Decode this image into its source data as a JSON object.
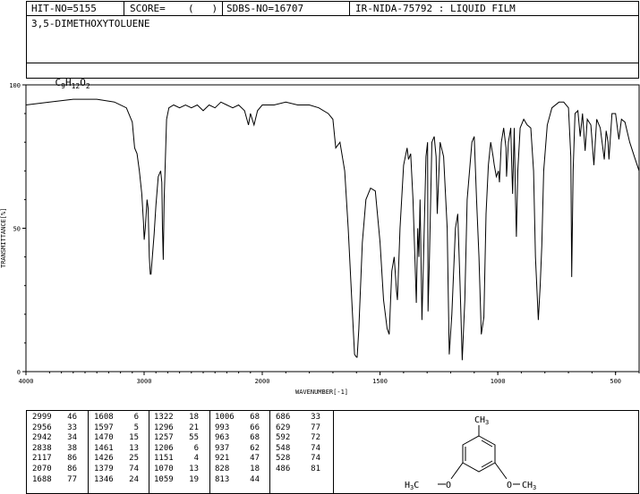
{
  "header": {
    "hit_no": "HIT-NO=5155",
    "score_label": "SCORE=",
    "score_value": "(   )",
    "sdbs_no": "SDBS-NO=16707",
    "ir_info": "IR-NIDA-75792 : LIQUID FILM",
    "compound_name": "3,5-DIMETHOXYTOLUENE",
    "formula_parts": [
      "C",
      "9",
      "H",
      "12",
      "O",
      "2"
    ]
  },
  "chart_data": {
    "type": "line",
    "xlabel": "WAVENUMBER[-1]",
    "ylabel": "TRANSMITTANCE[%]",
    "x_ticks": [
      "4000",
      "3000",
      "2000",
      "1500",
      "1000",
      "500"
    ],
    "y_ticks": [
      "0",
      "50",
      "100"
    ],
    "ylim": [
      0,
      100
    ],
    "xlim": [
      4000,
      400
    ],
    "x_scale": "split: 4000-2000 compressed, 2000-400 expanded",
    "grid": false,
    "series": [
      {
        "points": [
          [
            4000,
            93
          ],
          [
            3800,
            94
          ],
          [
            3600,
            95
          ],
          [
            3400,
            95
          ],
          [
            3250,
            94
          ],
          [
            3150,
            92
          ],
          [
            3100,
            87
          ],
          [
            3080,
            78
          ],
          [
            3060,
            76
          ],
          [
            3040,
            70
          ],
          [
            3020,
            62
          ],
          [
            3005,
            52
          ],
          [
            2999,
            46
          ],
          [
            2990,
            50
          ],
          [
            2975,
            60
          ],
          [
            2966,
            57
          ],
          [
            2956,
            40
          ],
          [
            2948,
            34
          ],
          [
            2942,
            34
          ],
          [
            2930,
            40
          ],
          [
            2915,
            48
          ],
          [
            2900,
            58
          ],
          [
            2880,
            68
          ],
          [
            2860,
            70
          ],
          [
            2850,
            66
          ],
          [
            2845,
            50
          ],
          [
            2838,
            39
          ],
          [
            2830,
            60
          ],
          [
            2810,
            88
          ],
          [
            2790,
            92
          ],
          [
            2750,
            93
          ],
          [
            2700,
            92
          ],
          [
            2650,
            93
          ],
          [
            2600,
            92
          ],
          [
            2550,
            93
          ],
          [
            2500,
            91
          ],
          [
            2450,
            93
          ],
          [
            2400,
            92
          ],
          [
            2350,
            94
          ],
          [
            2300,
            93
          ],
          [
            2250,
            92
          ],
          [
            2200,
            93
          ],
          [
            2150,
            91
          ],
          [
            2117,
            86
          ],
          [
            2100,
            90
          ],
          [
            2070,
            86
          ],
          [
            2040,
            91
          ],
          [
            2000,
            93
          ],
          [
            1950,
            93
          ],
          [
            1900,
            94
          ],
          [
            1850,
            93
          ],
          [
            1800,
            93
          ],
          [
            1760,
            92
          ],
          [
            1720,
            90
          ],
          [
            1700,
            88
          ],
          [
            1688,
            78
          ],
          [
            1670,
            80
          ],
          [
            1650,
            70
          ],
          [
            1635,
            50
          ],
          [
            1620,
            25
          ],
          [
            1608,
            6
          ],
          [
            1600,
            5
          ],
          [
            1597,
            5
          ],
          [
            1590,
            15
          ],
          [
            1575,
            45
          ],
          [
            1560,
            60
          ],
          [
            1540,
            64
          ],
          [
            1520,
            63
          ],
          [
            1500,
            45
          ],
          [
            1485,
            25
          ],
          [
            1470,
            15
          ],
          [
            1461,
            13
          ],
          [
            1450,
            35
          ],
          [
            1440,
            40
          ],
          [
            1430,
            28
          ],
          [
            1426,
            25
          ],
          [
            1415,
            50
          ],
          [
            1400,
            72
          ],
          [
            1385,
            78
          ],
          [
            1379,
            74
          ],
          [
            1370,
            76
          ],
          [
            1360,
            60
          ],
          [
            1350,
            35
          ],
          [
            1346,
            24
          ],
          [
            1340,
            50
          ],
          [
            1335,
            40
          ],
          [
            1330,
            60
          ],
          [
            1322,
            18
          ],
          [
            1315,
            40
          ],
          [
            1305,
            75
          ],
          [
            1298,
            80
          ],
          [
            1296,
            21
          ],
          [
            1290,
            40
          ],
          [
            1280,
            80
          ],
          [
            1270,
            82
          ],
          [
            1262,
            75
          ],
          [
            1257,
            55
          ],
          [
            1245,
            80
          ],
          [
            1230,
            75
          ],
          [
            1215,
            50
          ],
          [
            1206,
            6
          ],
          [
            1195,
            20
          ],
          [
            1180,
            50
          ],
          [
            1170,
            55
          ],
          [
            1160,
            30
          ],
          [
            1151,
            4
          ],
          [
            1140,
            25
          ],
          [
            1130,
            60
          ],
          [
            1110,
            80
          ],
          [
            1100,
            82
          ],
          [
            1090,
            60
          ],
          [
            1080,
            40
          ],
          [
            1070,
            13
          ],
          [
            1059,
            19
          ],
          [
            1050,
            55
          ],
          [
            1040,
            72
          ],
          [
            1030,
            80
          ],
          [
            1020,
            75
          ],
          [
            1015,
            72
          ],
          [
            1006,
            68
          ],
          [
            997,
            70
          ],
          [
            993,
            66
          ],
          [
            985,
            80
          ],
          [
            975,
            85
          ],
          [
            965,
            78
          ],
          [
            963,
            68
          ],
          [
            955,
            80
          ],
          [
            945,
            85
          ],
          [
            940,
            70
          ],
          [
            937,
            62
          ],
          [
            930,
            85
          ],
          [
            925,
            60
          ],
          [
            921,
            47
          ],
          [
            915,
            70
          ],
          [
            905,
            85
          ],
          [
            890,
            88
          ],
          [
            875,
            86
          ],
          [
            860,
            85
          ],
          [
            848,
            70
          ],
          [
            840,
            40
          ],
          [
            828,
            18
          ],
          [
            820,
            30
          ],
          [
            813,
            44
          ],
          [
            805,
            70
          ],
          [
            790,
            86
          ],
          [
            770,
            92
          ],
          [
            740,
            94
          ],
          [
            720,
            94
          ],
          [
            700,
            92
          ],
          [
            690,
            75
          ],
          [
            686,
            33
          ],
          [
            680,
            70
          ],
          [
            672,
            90
          ],
          [
            660,
            91
          ],
          [
            650,
            82
          ],
          [
            640,
            90
          ],
          [
            629,
            77
          ],
          [
            620,
            88
          ],
          [
            605,
            86
          ],
          [
            592,
            72
          ],
          [
            580,
            88
          ],
          [
            565,
            85
          ],
          [
            548,
            74
          ],
          [
            540,
            84
          ],
          [
            532,
            80
          ],
          [
            528,
            74
          ],
          [
            515,
            90
          ],
          [
            500,
            90
          ],
          [
            486,
            81
          ],
          [
            475,
            88
          ],
          [
            460,
            87
          ],
          [
            440,
            80
          ],
          [
            420,
            75
          ],
          [
            400,
            70
          ]
        ]
      }
    ]
  },
  "peaks": [
    [
      [
        "2999",
        "46"
      ],
      [
        "2956",
        "33"
      ],
      [
        "2942",
        "34"
      ],
      [
        "2838",
        "38"
      ],
      [
        "2117",
        "86"
      ],
      [
        "2070",
        "86"
      ],
      [
        "1688",
        "77"
      ]
    ],
    [
      [
        "1608",
        "6"
      ],
      [
        "1597",
        "5"
      ],
      [
        "1470",
        "15"
      ],
      [
        "1461",
        "13"
      ],
      [
        "1426",
        "25"
      ],
      [
        "1379",
        "74"
      ],
      [
        "1346",
        "24"
      ]
    ],
    [
      [
        "1322",
        "18"
      ],
      [
        "1296",
        "21"
      ],
      [
        "1257",
        "55"
      ],
      [
        "1206",
        "6"
      ],
      [
        "1151",
        "4"
      ],
      [
        "1070",
        "13"
      ],
      [
        "1059",
        "19"
      ]
    ],
    [
      [
        "1006",
        "68"
      ],
      [
        "993",
        "66"
      ],
      [
        "963",
        "68"
      ],
      [
        "937",
        "62"
      ],
      [
        "921",
        "47"
      ],
      [
        "828",
        "18"
      ],
      [
        "813",
        "44"
      ]
    ],
    [
      [
        "686",
        "33"
      ],
      [
        "629",
        "77"
      ],
      [
        "592",
        "72"
      ],
      [
        "548",
        "74"
      ],
      [
        "528",
        "74"
      ],
      [
        "486",
        "81"
      ],
      [
        "",
        ""
      ]
    ]
  ],
  "structure": {
    "methyl_label": "CH3",
    "left_label": "H3C",
    "right_label": "CH3",
    "oxygen_label": "O"
  }
}
